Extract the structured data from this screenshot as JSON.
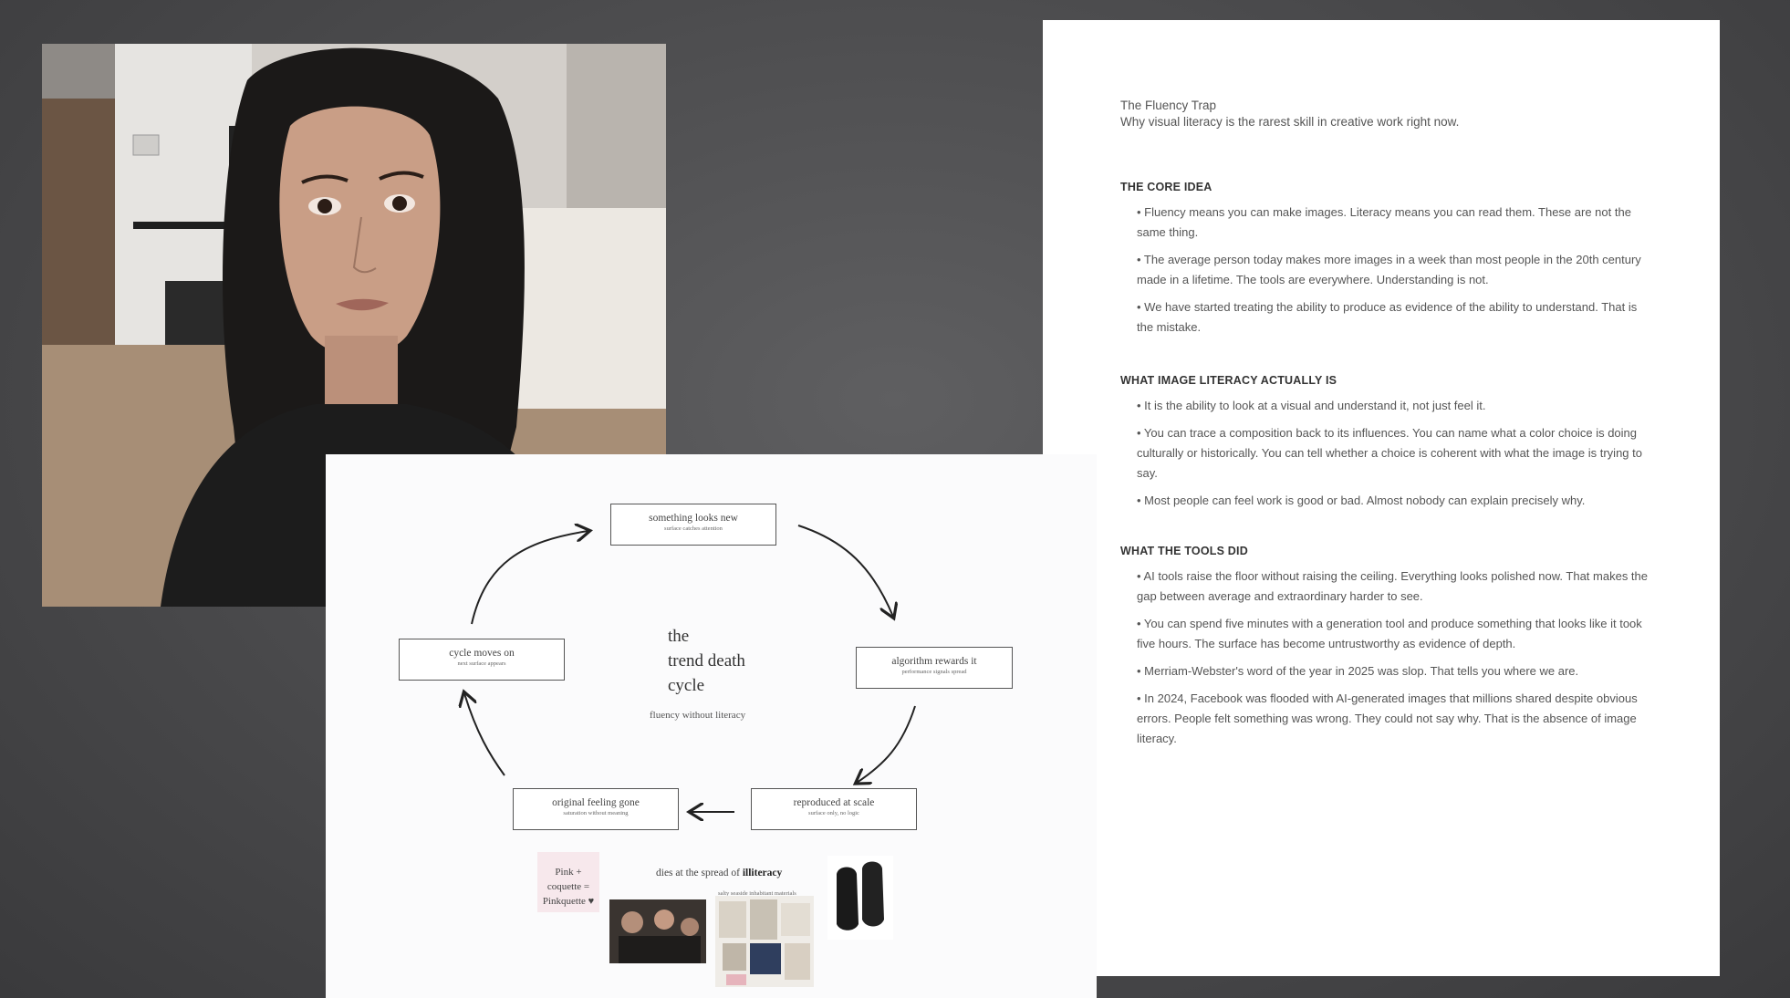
{
  "document": {
    "title": "The Fluency Trap",
    "subtitle": "Why visual literacy is the rarest skill in creative work right now.",
    "sections": [
      {
        "heading": "THE CORE IDEA",
        "bullets": [
          "• Fluency means you can make images. Literacy means you can read them. These are not the same thing.",
          "• The average person today makes more images in a week than most people in the 20th century made in a lifetime. The tools are everywhere. Understanding is not.",
          "• We have started treating the ability to produce as evidence of the ability to understand. That is the mistake."
        ]
      },
      {
        "heading": "WHAT IMAGE LITERACY ACTUALLY IS",
        "bullets": [
          "• It is the ability to look at a visual and understand it, not just feel it.",
          "• You can trace a composition back to its influences. You can name what a color choice is doing culturally or historically. You can tell whether a choice is coherent with what the image is trying to say.",
          "• Most people can feel work is good or bad. Almost nobody can explain precisely why."
        ]
      },
      {
        "heading": "WHAT THE TOOLS DID",
        "bullets": [
          "• AI tools raise the floor without raising the ceiling. Everything looks polished now. That makes the gap between average and extraordinary harder to see.",
          "• You can spend five minutes with a generation tool and produce something that looks like it took five hours. The surface has become untrustworthy as evidence of depth.",
          "• Merriam-Webster's word of the year in 2025 was slop. That tells you where we are.",
          "• In 2024, Facebook was flooded with AI-generated images that millions shared despite obvious errors. People felt something was wrong. They could not say why. That is the absence of image literacy."
        ]
      }
    ]
  },
  "diagram": {
    "center_title_lines": [
      "the",
      "trend death",
      "cycle"
    ],
    "center_subtitle": "fluency without literacy",
    "nodes": [
      {
        "main": "something looks new",
        "sub": "surface catches attention"
      },
      {
        "main": "algorithm rewards it",
        "sub": "performance signals spread"
      },
      {
        "main": "reproduced at scale",
        "sub": "surface only, no logic"
      },
      {
        "main": "original feeling gone",
        "sub": "saturation without meaning"
      },
      {
        "main": "cycle moves on",
        "sub": "next surface appears"
      }
    ],
    "caption_prefix": "dies at the spread of",
    "caption_bold": "illiteracy",
    "pink_note_line1": "Pink + coquette =",
    "pink_note_line2": "Pinkquette ♥",
    "collage_label": "salty seaside inhabitant materials"
  },
  "colors": {
    "background": "#4a4a4c",
    "document_bg": "#ffffff",
    "diagram_bg": "#fbfbfc",
    "pink_note": "#f7e8ec"
  }
}
